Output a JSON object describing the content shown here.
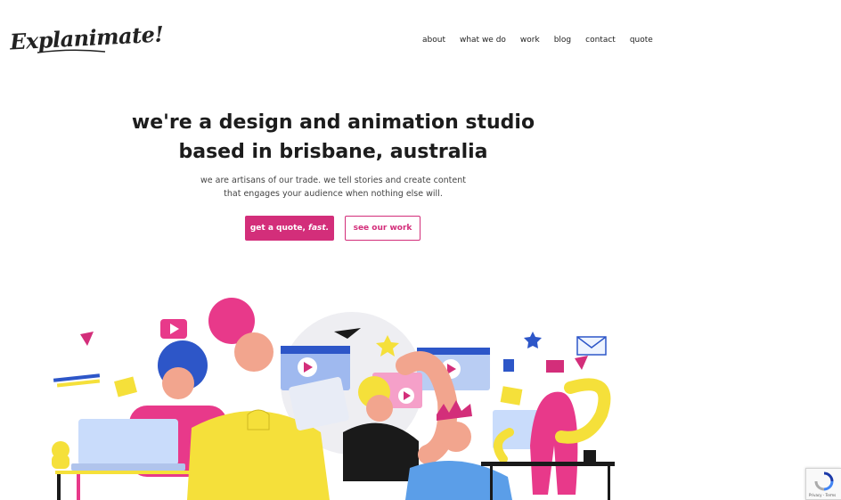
{
  "brand": {
    "logo_text": "Explanimate!"
  },
  "nav": {
    "items": [
      {
        "label": "about"
      },
      {
        "label": "what we do"
      },
      {
        "label": "work"
      },
      {
        "label": "blog"
      },
      {
        "label": "contact"
      },
      {
        "label": "quote"
      }
    ]
  },
  "hero": {
    "headline_line1": "we're a design and animation studio",
    "headline_line2": "based in brisbane, australia",
    "sub_line1": "we are artisans of our trade. we tell stories and create content",
    "sub_line2": "that engages your audience when nothing else will.",
    "cta_primary_main": "get a quote, ",
    "cta_primary_em": "fast.",
    "cta_secondary": "see our work"
  },
  "recaptcha": {
    "links": "Privacy - Terms"
  },
  "colors": {
    "accent": "#d32e7a",
    "pink": "#e8398a",
    "yellow": "#f5e03a",
    "blue": "#2d56c8",
    "skin": "#f2a58e"
  }
}
